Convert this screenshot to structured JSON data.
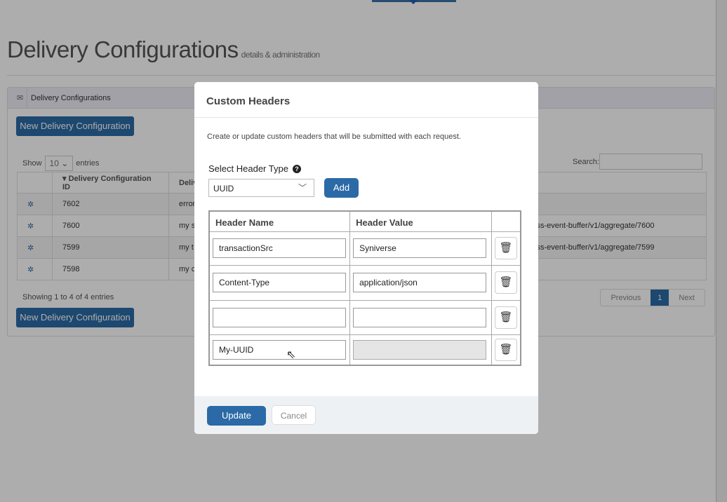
{
  "page": {
    "title": "Delivery Configurations",
    "subtitle": "details & administration"
  },
  "panel": {
    "heading": "Delivery Configurations",
    "new_button": "New Delivery Configuration",
    "show_label": "Show",
    "entries_value": "10",
    "entries_label": "entries",
    "search_label": "Search:",
    "search_value": "",
    "columns": [
      "",
      "Delivery Configuration ID",
      "Delive",
      ""
    ],
    "rows": [
      {
        "id": "7602",
        "desc": "error",
        "url": ""
      },
      {
        "id": "7600",
        "desc": "my s",
        "url": "ss-event-buffer/v1/aggregate/7600"
      },
      {
        "id": "7599",
        "desc": "my t",
        "url": "ss-event-buffer/v1/aggregate/7599"
      },
      {
        "id": "7598",
        "desc": "my c",
        "url": ""
      }
    ],
    "info": "Showing 1 to 4 of 4 entries",
    "pager": {
      "prev": "Previous",
      "current": "1",
      "next": "Next"
    }
  },
  "modal": {
    "title": "Custom Headers",
    "description": "Create or update custom headers that will be submitted with each request.",
    "select_label": "Select Header Type",
    "select_value": "UUID",
    "add_label": "Add",
    "col_name": "Header Name",
    "col_value": "Header Value",
    "rows": [
      {
        "name": "transactionSrc",
        "value": "Syniverse"
      },
      {
        "name": "Content-Type",
        "value": "application/json"
      },
      {
        "name": "",
        "value": ""
      },
      {
        "name": "My-UUID",
        "value": ""
      }
    ],
    "update_label": "Update",
    "cancel_label": "Cancel"
  },
  "colors": {
    "primary": "#2b6aa6",
    "overlay": "rgba(0,0,0,0.32)"
  }
}
